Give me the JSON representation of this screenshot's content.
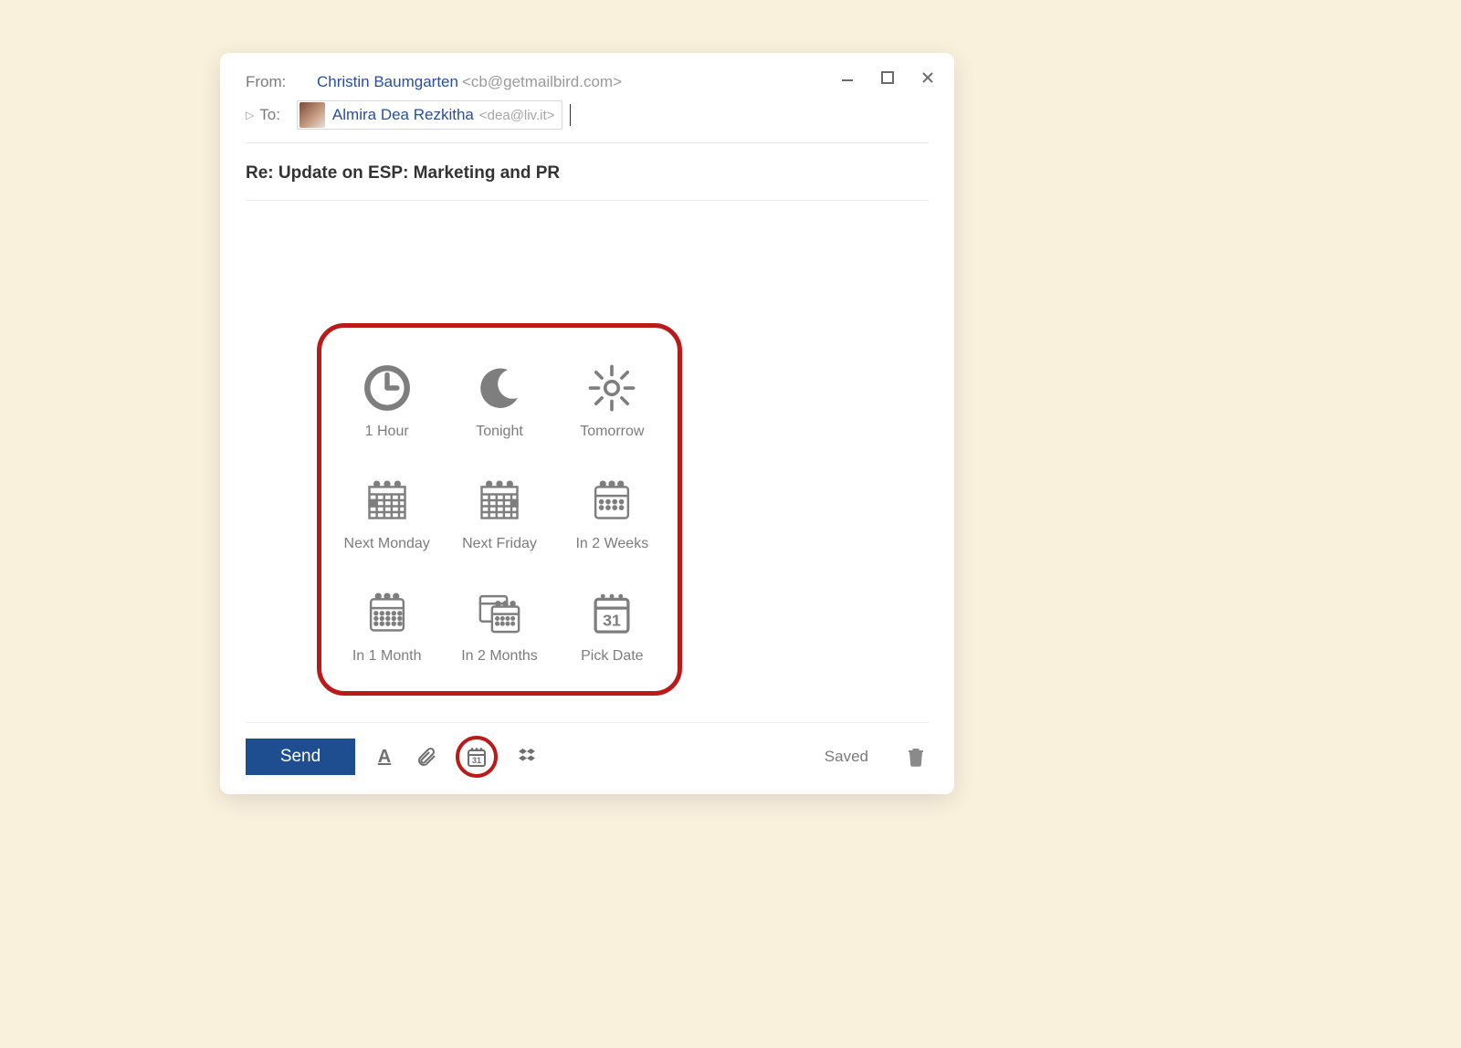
{
  "window": {
    "minimize": "–",
    "maximize": "□",
    "close": "✕"
  },
  "from": {
    "label": "From:",
    "name": "Christin Baumgarten",
    "email": "<cb@getmailbird.com>"
  },
  "to": {
    "label": "To:",
    "recipient": {
      "name": "Almira Dea Rezkitha",
      "email": "<dea@liv.it>"
    }
  },
  "subject": "Re: Update on ESP: Marketing and PR",
  "snooze": {
    "options": [
      "1 Hour",
      "Tonight",
      "Tomorrow",
      "Next Monday",
      "Next Friday",
      "In 2 Weeks",
      "In 1 Month",
      "In 2 Months",
      "Pick Date"
    ],
    "pick_date_number": "31",
    "toolbar_icon_number": "31"
  },
  "toolbar": {
    "send": "Send",
    "status": "Saved"
  }
}
